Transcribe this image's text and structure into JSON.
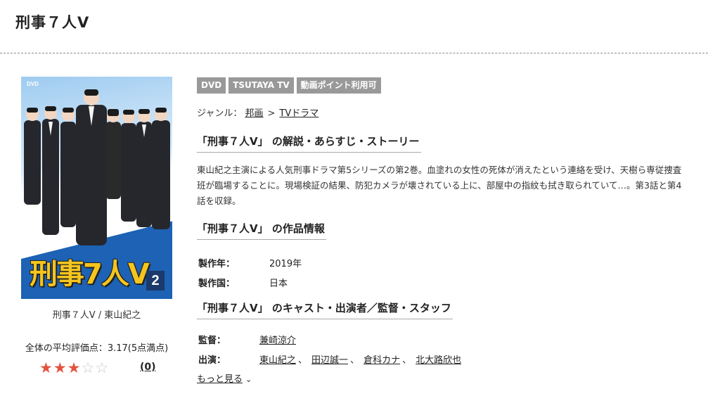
{
  "page": {
    "title": "刑事７人Ⅴ"
  },
  "cover": {
    "dvd_label": "DVD",
    "title_text": "刑事7人V",
    "volume": "2",
    "caption": "刑事７人Ⅴ / 東山紀之"
  },
  "rating": {
    "average_label": "全体の平均評価点：3.17(5点満点)",
    "stars_filled": 3,
    "stars_total": 5,
    "star_icon": "star-icon",
    "review_count": "(0)"
  },
  "badges": [
    "DVD",
    "TSUTAYA TV",
    "動画ポイント利用可"
  ],
  "genre": {
    "label": "ジャンル：",
    "items": [
      "邦画",
      "TVドラマ"
    ],
    "separator": ">"
  },
  "synopsis": {
    "heading": "「刑事７人Ⅴ」 の解説・あらすじ・ストーリー",
    "text": "東山紀之主演による人気刑事ドラマ第5シリーズの第2巻。血塗れの女性の死体が消えたという連絡を受け、天樹ら専従捜査班が臨場することに。現場検証の結果、防犯カメラが壊されている上に、部屋中の指紋も拭き取られていて…。第3話と第4話を収録。"
  },
  "info": {
    "heading": "「刑事７人Ⅴ」 の作品情報",
    "rows": [
      {
        "label": "製作年：",
        "value": "2019年"
      },
      {
        "label": "製作国：",
        "value": "日本"
      }
    ]
  },
  "cast": {
    "heading": "「刑事７人Ⅴ」 のキャスト・出演者／監督・スタッフ",
    "director_label": "監督：",
    "directors": [
      "兼崎涼介"
    ],
    "actors_label": "出演：",
    "actors": [
      "東山紀之",
      "田辺誠一",
      "倉科カナ",
      "北大路欣也"
    ],
    "separator": "、",
    "more_label": "もっと見る",
    "more_icon": "chevron-down-icon"
  },
  "colors": {
    "star_on": "#e4523d",
    "star_off": "#c9c9c9",
    "badge_bg": "#999999",
    "cover_title": "#f4c51e",
    "cover_band": "#1d62b4"
  }
}
